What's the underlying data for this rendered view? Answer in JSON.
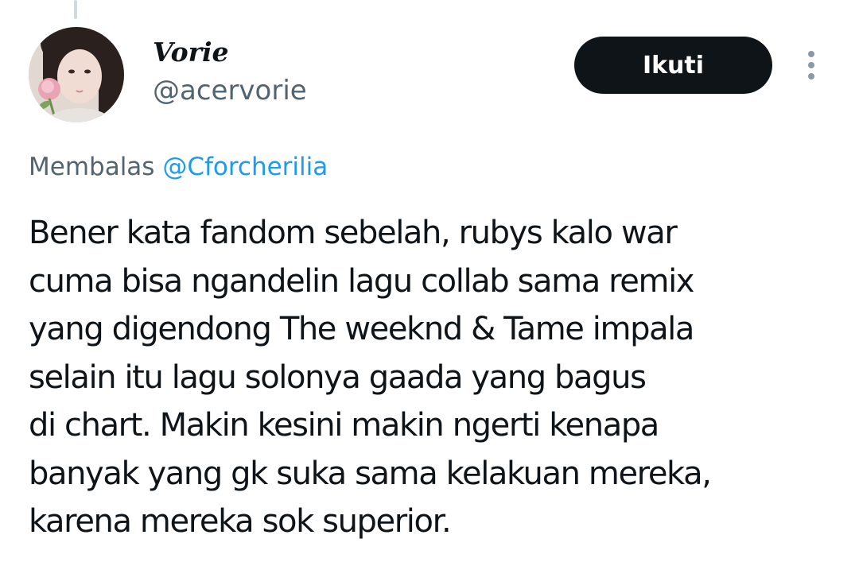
{
  "author": {
    "display_name": "Vorie",
    "handle": "@acervorie"
  },
  "follow_button": {
    "label": "Ikuti"
  },
  "reply_context": {
    "prefix": "Membalas",
    "mention": "@Cforcherilia"
  },
  "tweet": {
    "lines": [
      "Bener kata fandom sebelah, rubys kalo war",
      "cuma bisa ngandelin lagu collab sama remix",
      "yang digendong The weeknd & Tame impala",
      "selain itu lagu solonya gaada yang bagus",
      "di chart. Makin kesini makin ngerti kenapa",
      "banyak yang gk suka sama kelakuan mereka,",
      "karena mereka sok superior."
    ]
  },
  "icons": {
    "more": "more-vertical-icon"
  },
  "colors": {
    "text_primary": "#0f1419",
    "text_secondary": "#536471",
    "link": "#1d9bf0",
    "button_bg": "#0f1419",
    "button_text": "#ffffff"
  }
}
